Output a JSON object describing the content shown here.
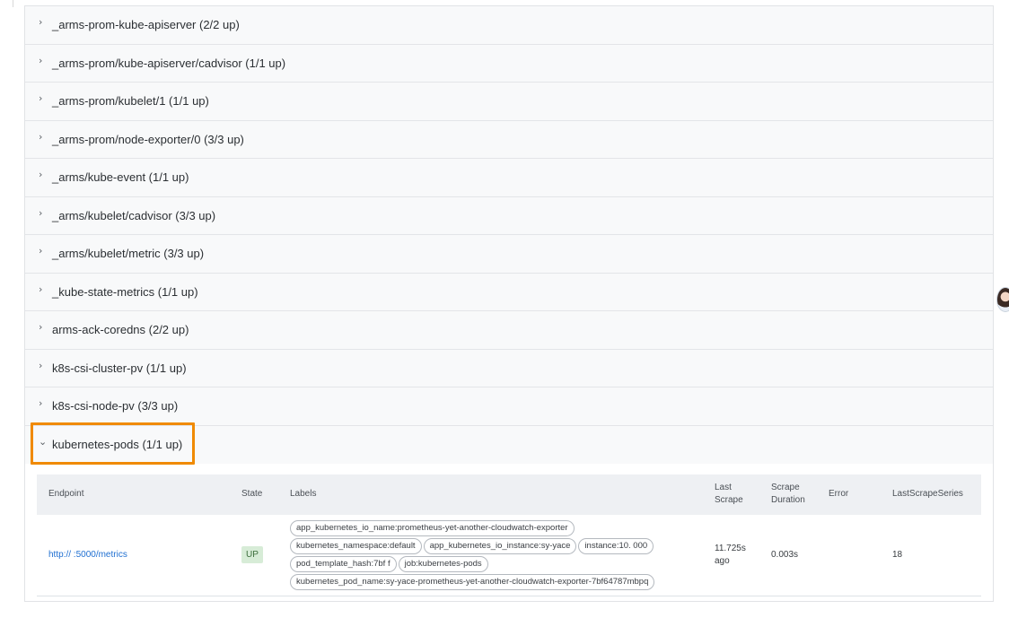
{
  "jobs": [
    {
      "label": "_arms-prom-kube-apiserver (2/2 up)"
    },
    {
      "label": "_arms-prom/kube-apiserver/cadvisor (1/1 up)"
    },
    {
      "label": "_arms-prom/kubelet/1 (1/1 up)"
    },
    {
      "label": "_arms-prom/node-exporter/0 (3/3 up)"
    },
    {
      "label": "_arms/kube-event (1/1 up)"
    },
    {
      "label": "_arms/kubelet/cadvisor (3/3 up)"
    },
    {
      "label": "_arms/kubelet/metric (3/3 up)"
    },
    {
      "label": "_kube-state-metrics (1/1 up)"
    },
    {
      "label": "arms-ack-coredns (2/2 up)"
    },
    {
      "label": "k8s-csi-cluster-pv (1/1 up)"
    },
    {
      "label": "k8s-csi-node-pv (3/3 up)"
    }
  ],
  "icons": {
    "collapsed": "chevron-right-icon",
    "expanded": "chevron-down-icon"
  },
  "highlight_color": "#f08a00",
  "expanded_job": {
    "label": "kubernetes-pods (1/1 up)",
    "table": {
      "headers": {
        "endpoint": "Endpoint",
        "state": "State",
        "labels": "Labels",
        "last_scrape": "Last Scrape",
        "scrape_duration": "Scrape Duration",
        "error": "Error",
        "last_scrape_series": "LastScrapeSeries"
      },
      "row": {
        "endpoint": "http://          :5000/metrics",
        "state": "UP",
        "labels": [
          "app_kubernetes_io_name:prometheus-yet-another-cloudwatch-exporter",
          "kubernetes_namespace:default",
          "app_kubernetes_io_instance:sy-yace",
          "instance:10.          000",
          "pod_template_hash:7bf      f",
          "job:kubernetes-pods",
          "kubernetes_pod_name:sy-yace-prometheus-yet-another-cloudwatch-exporter-7bf64787mbpq"
        ],
        "last_scrape": "11.725s ago",
        "scrape_duration": "0.003s",
        "error": "",
        "last_scrape_series": "18"
      }
    }
  }
}
